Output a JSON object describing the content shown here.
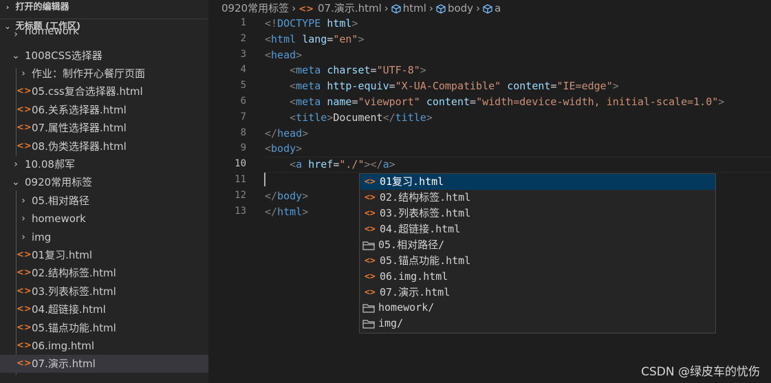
{
  "sidebar": {
    "open_editors_label": "打开的编辑器",
    "workspace_label": "无标题 (工作区)",
    "items": [
      {
        "label": "homework",
        "kind": "folder",
        "expanded": false
      },
      {
        "label": "1008CSS选择器",
        "kind": "folder",
        "expanded": true
      },
      {
        "label": "作业：制作开心餐厅页面",
        "kind": "folder",
        "expanded": false
      },
      {
        "label": "05.css复合选择器.html",
        "kind": "html"
      },
      {
        "label": "06.关系选择器.html",
        "kind": "html"
      },
      {
        "label": "07.属性选择器.html",
        "kind": "html"
      },
      {
        "label": "08.伪类选择器.html",
        "kind": "html"
      },
      {
        "label": "10.08郝军",
        "kind": "folder",
        "expanded": false
      },
      {
        "label": "0920常用标签",
        "kind": "folder",
        "expanded": true
      },
      {
        "label": "05.相对路径",
        "kind": "folder",
        "expanded": false
      },
      {
        "label": "homework",
        "kind": "folder",
        "expanded": false
      },
      {
        "label": "img",
        "kind": "folder",
        "expanded": false
      },
      {
        "label": "01复习.html",
        "kind": "html"
      },
      {
        "label": "02.结构标签.html",
        "kind": "html"
      },
      {
        "label": "03.列表标签.html",
        "kind": "html"
      },
      {
        "label": "04.超链接.html",
        "kind": "html"
      },
      {
        "label": "05.锚点功能.html",
        "kind": "html"
      },
      {
        "label": "06.img.html",
        "kind": "html"
      },
      {
        "label": "07.演示.html",
        "kind": "html",
        "selected": true
      }
    ]
  },
  "breadcrumb": {
    "folder": "0920常用标签",
    "file": "07.演示.html",
    "html": "html",
    "body": "body",
    "a": "a"
  },
  "editor": {
    "line_numbers": [
      "1",
      "2",
      "3",
      "4",
      "5",
      "6",
      "7",
      "8",
      "9",
      "10",
      "11",
      "12",
      "13"
    ],
    "active_line": "10",
    "lines": {
      "l1": {
        "b1": "<!",
        "doctype": "DOCTYPE",
        "html": "html",
        "b2": ">"
      },
      "l2": {
        "b1": "<",
        "tag": "html",
        "attr": "lang",
        "eq": "=",
        "val": "\"en\"",
        "b2": ">"
      },
      "l3": {
        "b1": "<",
        "tag": "head",
        "b2": ">"
      },
      "l4": {
        "b1": "<",
        "tag": "meta",
        "attr": "charset",
        "eq": "=",
        "val": "\"UTF-8\"",
        "b2": ">"
      },
      "l5": {
        "b1": "<",
        "tag": "meta",
        "attr1": "http-equiv",
        "eq1": "=",
        "val1": "\"X-UA-Compatible\"",
        "attr2": "content",
        "eq2": "=",
        "val2": "\"IE=edge\"",
        "b2": ">"
      },
      "l6": {
        "b1": "<",
        "tag": "meta",
        "attr1": "name",
        "eq1": "=",
        "val1": "\"viewport\"",
        "attr2": "content",
        "eq2": "=",
        "val2": "\"width=device-width, initial-scale=1.0\"",
        "b2": ">"
      },
      "l7": {
        "b1": "<",
        "tag": "title",
        "b2": ">",
        "text": "Document",
        "b3": "</",
        "tag2": "title",
        "b4": ">"
      },
      "l8": {
        "b1": "</",
        "tag": "head",
        "b2": ">"
      },
      "l9": {
        "b1": "<",
        "tag": "body",
        "b2": ">"
      },
      "l10": {
        "b1": "<",
        "tag": "a",
        "attr": "href",
        "eq": "=",
        "val": "\"./\"",
        "b2": ">",
        "b3": "</",
        "tag2": "a",
        "b4": ">"
      },
      "l12": {
        "b1": "</",
        "tag": "body",
        "b2": ">"
      },
      "l13": {
        "b1": "</",
        "tag": "html",
        "b2": ">"
      }
    }
  },
  "suggest": {
    "items": [
      {
        "label": "01复习.html",
        "kind": "file",
        "focused": true
      },
      {
        "label": "02.结构标签.html",
        "kind": "file"
      },
      {
        "label": "03.列表标签.html",
        "kind": "file"
      },
      {
        "label": "04.超链接.html",
        "kind": "file"
      },
      {
        "label": "05.相对路径/",
        "kind": "folder"
      },
      {
        "label": "05.锚点功能.html",
        "kind": "file"
      },
      {
        "label": "06.img.html",
        "kind": "file"
      },
      {
        "label": "07.演示.html",
        "kind": "file"
      },
      {
        "label": "homework/",
        "kind": "folder"
      },
      {
        "label": "img/",
        "kind": "folder"
      }
    ]
  },
  "icons": {
    "html_file": "<>",
    "chevron_down": "⌄",
    "chevron_right": "›"
  },
  "watermark": "CSDN @绿皮车的忧伤",
  "colors": {
    "file_icon": "#e37933",
    "tag": "#569cd6",
    "attribute": "#9cdcfe",
    "string": "#ce9178",
    "suggest_focus": "#04395e"
  }
}
